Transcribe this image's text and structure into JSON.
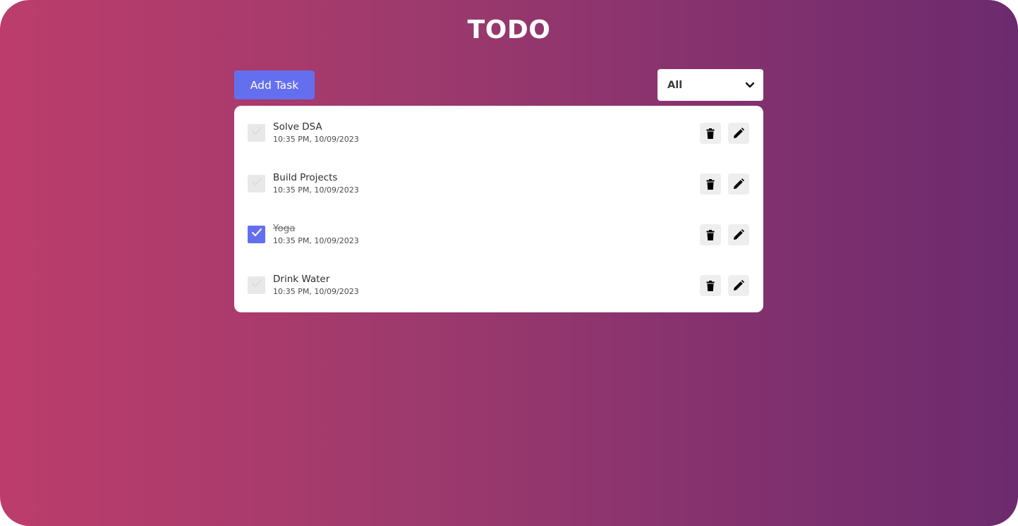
{
  "app": {
    "title": "TODO"
  },
  "toolbar": {
    "add_label": "Add Task",
    "filter_value": "All",
    "filter_icon": "chevron-down-icon"
  },
  "colors": {
    "accent": "#646ff0",
    "gradient_start": "#bc3d6b",
    "gradient_end": "#6c2b6e",
    "checkbox_unchecked": "#e8e8e8",
    "icon_button_bg": "#eeeeee"
  },
  "tasks": [
    {
      "name": "Solve DSA",
      "time": "10:35 PM, 10/09/2023",
      "completed": false
    },
    {
      "name": "Build Projects",
      "time": "10:35 PM, 10/09/2023",
      "completed": false
    },
    {
      "name": "Yoga",
      "time": "10:35 PM, 10/09/2023",
      "completed": true
    },
    {
      "name": "Drink Water",
      "time": "10:35 PM, 10/09/2023",
      "completed": false
    }
  ],
  "icons": {
    "checkbox": "check-icon",
    "delete": "trash-icon",
    "edit": "pencil-icon"
  }
}
